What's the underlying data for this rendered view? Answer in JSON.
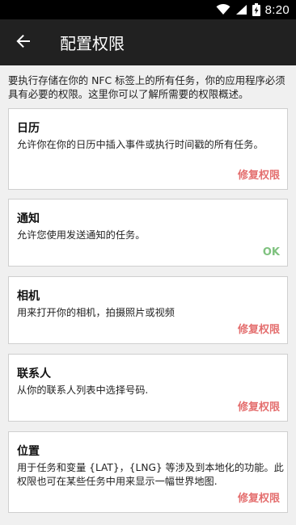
{
  "status_bar": {
    "time": "8:20",
    "icons": [
      "wifi-icon",
      "signal-icon",
      "battery-charging-icon"
    ]
  },
  "app_bar": {
    "title": "配置权限",
    "back_icon": "arrow-back-icon"
  },
  "intro": "要执行存储在你的 NFC 标签上的所有任务，你的应用程序必须具有必要的权限。这里你可以了解所需要的权限概述。",
  "permissions": [
    {
      "title": "日历",
      "description": "允许你在你的日历中插入事件或执行时间戳的所有任务。",
      "action": "修复权限"
    },
    {
      "title": "通知",
      "description": "允许您使用发送通知的任务。",
      "action": "OK"
    },
    {
      "title": "相机",
      "description": "用来打开你的相机，拍摄照片或视频",
      "action": "修复权限"
    },
    {
      "title": "联系人",
      "description": "从你的联系人列表中选择号码.",
      "action": "修复权限"
    },
    {
      "title": "位置",
      "description": "用于任务和变量 {LAT}，{LNG} 等涉及到本地化的功能。此权限也可在某些任务中用来显示一幅世界地图.",
      "action": "修复权限"
    }
  ],
  "colors": {
    "app_bar": "#212121",
    "fix_action": "#e46f6f",
    "ok_action": "#7fc27f",
    "background": "#f0f0f0"
  }
}
